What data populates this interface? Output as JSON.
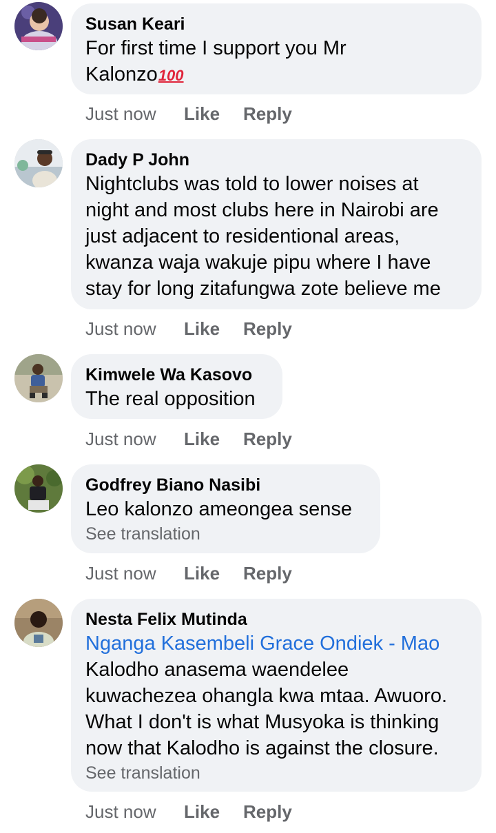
{
  "comments": [
    {
      "author": "Susan Keari",
      "text": "For first time I support you Mr\nKalonzo",
      "emoji": "100",
      "time": "Just now",
      "like": "Like",
      "reply": "Reply"
    },
    {
      "author": "Dady P John",
      "text": "Nightclubs was told to lower noises at\nnight and most clubs here in Nairobi are\njust adjacent to residentional areas,\nkwanza waja wakuje pipu where I have\nstay for long zitafungwa zote believe me",
      "time": "Just now",
      "like": "Like",
      "reply": "Reply"
    },
    {
      "author": "Kimwele Wa Kasovo",
      "text": "The real opposition",
      "time": "Just now",
      "like": "Like",
      "reply": "Reply"
    },
    {
      "author": "Godfrey Biano Nasibi",
      "text": "Leo kalonzo ameongea sense",
      "see_translation": "See translation",
      "time": "Just now",
      "like": "Like",
      "reply": "Reply"
    },
    {
      "author": "Nesta Felix Mutinda",
      "mention": "Nganga Kasembeli Grace Ondiek - Mao",
      "text": "Kalodho anasema waendelee\nkuwachezea ohangla kwa mtaa. Awuoro.\nWhat I don't is what Musyoka is thinking\nnow that Kalodho is against the closure.",
      "see_translation": "See translation",
      "time": "Just now",
      "like": "Like",
      "reply": "Reply"
    }
  ],
  "colors": {
    "bubble": "#f0f2f5",
    "meta": "#65676b",
    "mention": "#216fdb"
  }
}
